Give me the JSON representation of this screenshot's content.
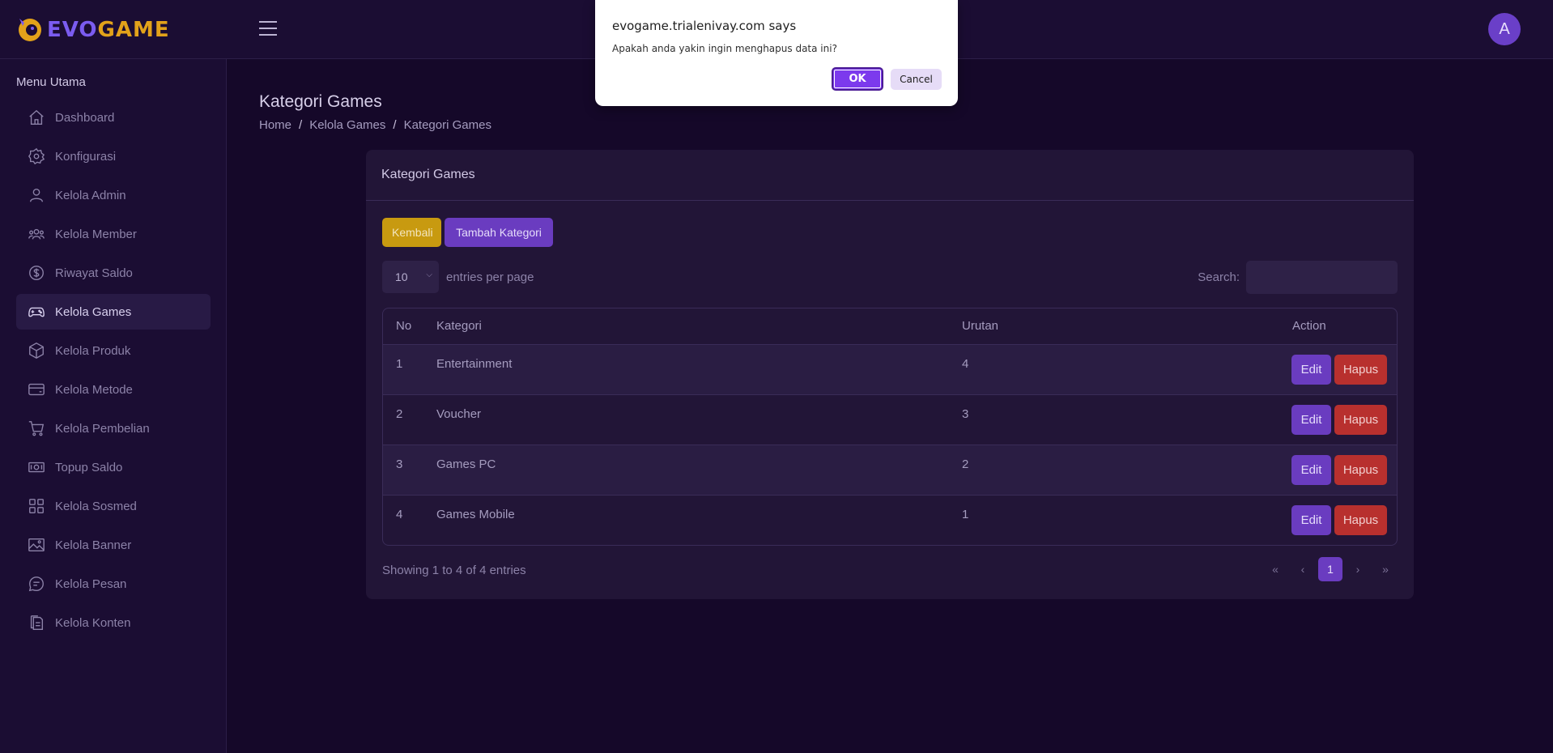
{
  "header": {
    "logo_evo": "EVO",
    "logo_game": "GAME",
    "avatar_letter": "A"
  },
  "sidebar": {
    "title": "Menu Utama",
    "items": [
      {
        "label": "Dashboard",
        "icon": "home-icon"
      },
      {
        "label": "Konfigurasi",
        "icon": "gear-icon"
      },
      {
        "label": "Kelola Admin",
        "icon": "user-icon"
      },
      {
        "label": "Kelola Member",
        "icon": "users-icon"
      },
      {
        "label": "Riwayat Saldo",
        "icon": "dollar-icon"
      },
      {
        "label": "Kelola Games",
        "icon": "gamepad-icon"
      },
      {
        "label": "Kelola Produk",
        "icon": "box-icon"
      },
      {
        "label": "Kelola Metode",
        "icon": "card-icon"
      },
      {
        "label": "Kelola Pembelian",
        "icon": "cart-icon"
      },
      {
        "label": "Topup Saldo",
        "icon": "money-icon"
      },
      {
        "label": "Kelola Sosmed",
        "icon": "grid-icon"
      },
      {
        "label": "Kelola Banner",
        "icon": "image-icon"
      },
      {
        "label": "Kelola Pesan",
        "icon": "chat-icon"
      },
      {
        "label": "Kelola Konten",
        "icon": "document-icon"
      }
    ],
    "active_index": 5
  },
  "main": {
    "page_title": "Kategori Games",
    "breadcrumb": [
      "Home",
      "Kelola Games",
      "Kategori Games"
    ],
    "breadcrumb_sep": "/",
    "card_title": "Kategori Games",
    "back_label": "Kembali",
    "add_label": "Tambah Kategori",
    "entries_value": "10",
    "entries_label": "entries per page",
    "search_label": "Search:",
    "search_value": "",
    "columns": [
      "No",
      "Kategori",
      "Urutan",
      "Action"
    ],
    "rows": [
      {
        "no": "1",
        "kategori": "Entertainment",
        "urutan": "4"
      },
      {
        "no": "2",
        "kategori": "Voucher",
        "urutan": "3"
      },
      {
        "no": "3",
        "kategori": "Games PC",
        "urutan": "2"
      },
      {
        "no": "4",
        "kategori": "Games Mobile",
        "urutan": "1"
      }
    ],
    "edit_label": "Edit",
    "delete_label": "Hapus",
    "showing": "Showing 1 to 4 of 4 entries",
    "pager": {
      "first": "«",
      "prev": "‹",
      "current": "1",
      "next": "›",
      "last": "»"
    }
  },
  "dialog": {
    "title": "evogame.trialenivay.com says",
    "message": "Apakah anda yakin ingin menghapus data ini?",
    "ok_label": "OK",
    "cancel_label": "Cancel"
  },
  "colors": {
    "accent": "#6a3cc0",
    "warning": "#c89a10",
    "danger": "#b8302e",
    "background": "#150829"
  }
}
